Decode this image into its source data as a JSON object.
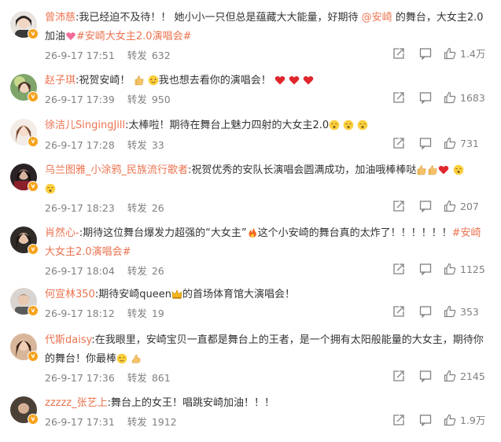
{
  "colors": {
    "accent": "#eb7350",
    "text": "#333333",
    "meta": "#808080",
    "verified_badge": "#f7a21b"
  },
  "comments": [
    {
      "user": "曾沛慈",
      "parts": [
        ":我已经迫不及待！！ 她小小一只但总是蕴藏大大能量，好期待 ",
        "@安崎",
        " 的舞台，大女主2.0加油",
        "#安崎大女主2.0演唱会#"
      ],
      "time": "26-9-17 17:51",
      "repost_label": "转发",
      "repost_count": "632",
      "likes": "1.4万"
    },
    {
      "user": "赵子琪",
      "parts": [
        ":祝贺安崎！",
        "我也想去看你的演唱会！"
      ],
      "time": "26-9-17 17:39",
      "repost_label": "转发",
      "repost_count": "950",
      "likes": "1683"
    },
    {
      "user": "徐洁儿SingingJill",
      "parts": [
        ":太棒啦！期待在舞台上魅力四射的大女主2.0"
      ],
      "time": "26-9-17 17:28",
      "repost_label": "转发",
      "repost_count": "33",
      "likes": "731"
    },
    {
      "user": "乌兰图雅_小涂鸦_民族流行歌者",
      "parts": [
        ":祝贺优秀的安队长演唱会圆满成功，加油哦棒棒哒"
      ],
      "time": "26-9-17 18:23",
      "repost_label": "转发",
      "repost_count": "26",
      "likes": "207"
    },
    {
      "user": "肖然心-",
      "parts": [
        ":期待这位舞台爆发力超强的“大女主”",
        "这个小安崎的舞台真的太炸了！！！！！！",
        "#安崎大女主2.0演唱会#"
      ],
      "time": "26-9-17 18:04",
      "repost_label": "转发",
      "repost_count": "26",
      "likes": "1125"
    },
    {
      "user": "何宣林350",
      "parts": [
        ":期待安崎queen",
        "的首场体育馆大演唱会！"
      ],
      "time": "26-9-17 18:12",
      "repost_label": "转发",
      "repost_count": "19",
      "likes": "353"
    },
    {
      "user": "代斯daisy",
      "parts": [
        ":在我眼里，安崎宝贝一直都是舞台上的王者，是一个拥有太阳般能量的大女主，期待你的舞台！你最棒"
      ],
      "time": "26-9-17 17:36",
      "repost_label": "转发",
      "repost_count": "861",
      "likes": "2145"
    },
    {
      "user": "zzzzz_张艺上",
      "parts": [
        ":舞台上的女王！唱跳安崎加油！！！"
      ],
      "time": "26-9-17 17:31",
      "repost_label": "转发",
      "repost_count": "1912",
      "likes": "1.9万"
    }
  ]
}
